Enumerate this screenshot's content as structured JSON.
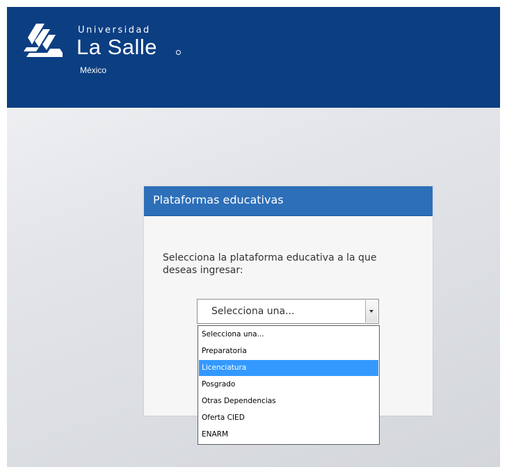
{
  "logo": {
    "university": "Universidad",
    "name": "La Salle",
    "country": "México"
  },
  "panel": {
    "title": "Plataformas educativas",
    "instruction": "Selecciona la plataforma educativa a la que deseas ingresar:"
  },
  "select": {
    "value": "Selecciona una...",
    "highlighted_index": 2,
    "options": [
      "Selecciona una...",
      "Preparatoria",
      "Licenciatura",
      "Posgrado",
      "Otras Dependencias",
      "Oferta CIED",
      "ENARM"
    ]
  },
  "colors": {
    "header_bg": "#0c3e82",
    "panel_title_bg": "#2d6fb9",
    "option_highlight": "#3399ff"
  }
}
